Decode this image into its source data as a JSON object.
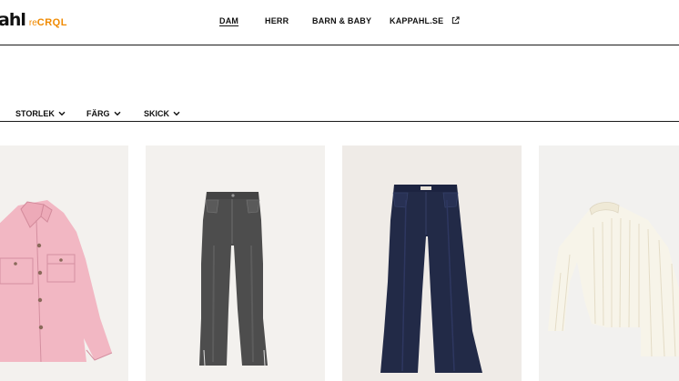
{
  "brand": {
    "logo_main": "ahl",
    "logo_sub_prefix": "re",
    "logo_sub_bold": "CRQL",
    "accent": "#f08a00"
  },
  "nav": {
    "items": [
      {
        "label": "DAM",
        "active": true
      },
      {
        "label": "HERR"
      },
      {
        "label": "BARN & BABY"
      },
      {
        "label": "KAPPAHL.SE",
        "icon": "external-link-icon"
      }
    ]
  },
  "filters": [
    {
      "label": "STORLEK",
      "icon": "chevron-down-icon"
    },
    {
      "label": "FÄRG",
      "icon": "chevron-down-icon"
    },
    {
      "label": "SKICK",
      "icon": "chevron-down-icon"
    }
  ],
  "products": [
    {
      "image": "pink-shirt-jacket",
      "background": "#f3f1ee",
      "color": "#f1b3c0"
    },
    {
      "image": "grey-flared-jeans",
      "background": "#f3f1ee",
      "color": "#505050"
    },
    {
      "image": "navy-wide-leg-jeans",
      "background": "#efebe7",
      "color": "#242c48"
    },
    {
      "image": "cream-rib-sweater",
      "background": "#f2f1ef",
      "color": "#f6f3e8"
    }
  ]
}
